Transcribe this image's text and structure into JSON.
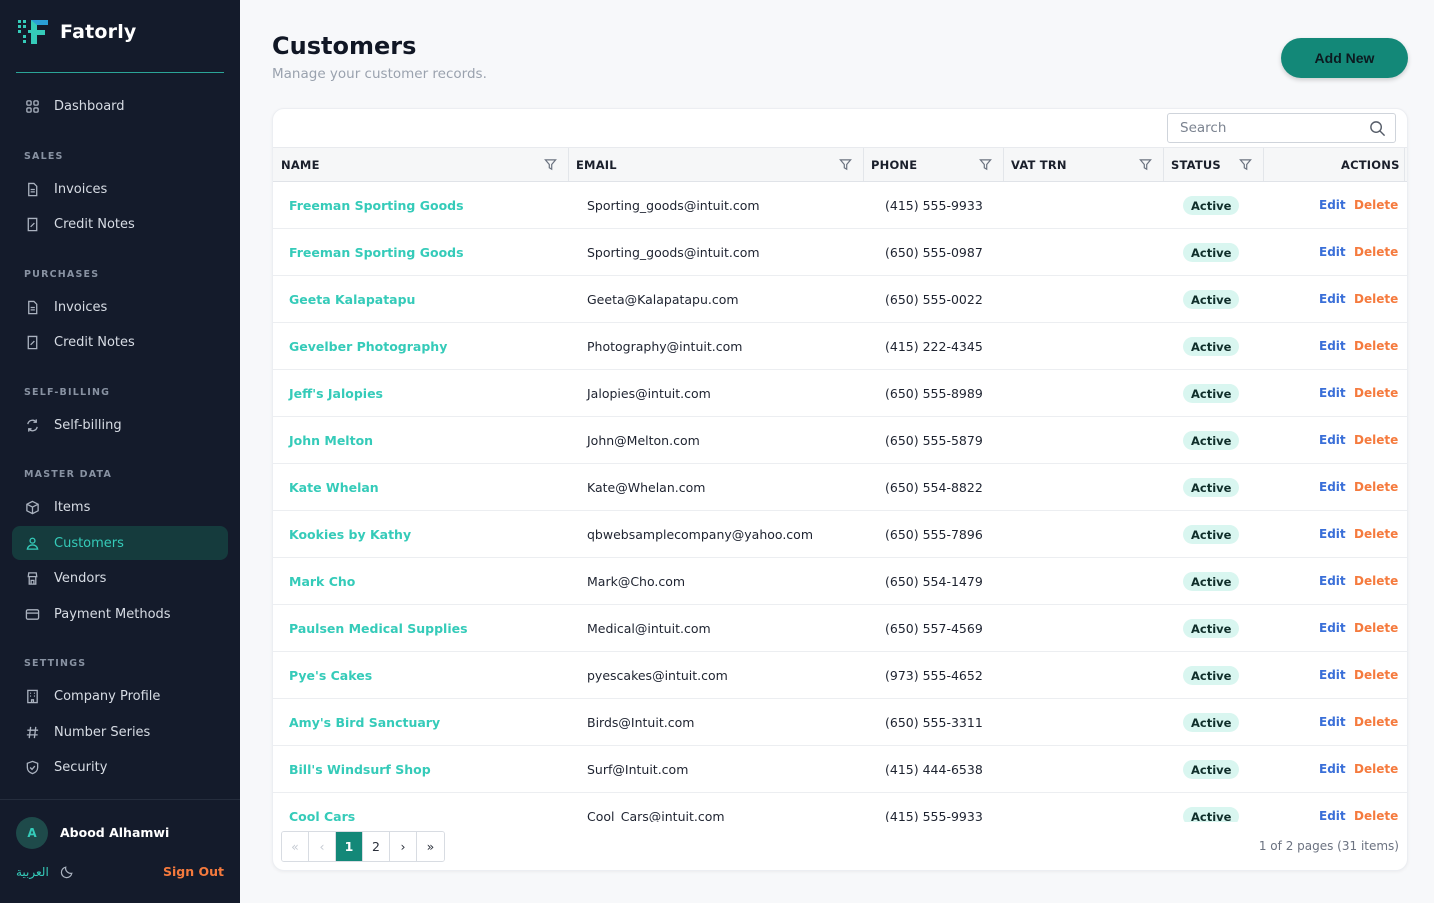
{
  "app": {
    "name": "Fatorly"
  },
  "colors": {
    "accent": "#138878",
    "link": "#35cbb9",
    "danger": "#f57a3d",
    "edit": "#3a6fd8",
    "sidebar": "#141b2b"
  },
  "sidebar": {
    "dashboard": "Dashboard",
    "sections": {
      "sales": "SALES",
      "purchases": "PURCHASES",
      "self_billing": "SELF-BILLING",
      "master_data": "MASTER DATA",
      "settings": "SETTINGS"
    },
    "sales_invoices": "Invoices",
    "sales_credit_notes": "Credit Notes",
    "purchases_invoices": "Invoices",
    "purchases_credit_notes": "Credit Notes",
    "self_billing": "Self-billing",
    "items": "Items",
    "customers": "Customers",
    "vendors": "Vendors",
    "payment_methods": "Payment Methods",
    "company_profile": "Company Profile",
    "number_series": "Number Series",
    "security": "Security",
    "active_item": "Customers"
  },
  "user": {
    "initial": "A",
    "name": "Abood Alhamwi",
    "language": "العربية",
    "sign_out": "Sign Out"
  },
  "header": {
    "title": "Customers",
    "subtitle": "Manage your customer records.",
    "add_button": "Add New"
  },
  "search": {
    "placeholder": "Search"
  },
  "table": {
    "columns": {
      "name": "NAME",
      "email": "EMAIL",
      "phone": "PHONE",
      "vat": "VAT TRN",
      "status": "STATUS",
      "actions": "ACTIONS"
    },
    "edit_label": "Edit",
    "delete_label": "Delete",
    "rows": [
      {
        "name": "Freeman Sporting Goods",
        "email": "Sporting_goods@intuit.com",
        "phone": "(415) 555-9933",
        "vat": "",
        "status": "Active"
      },
      {
        "name": "Freeman Sporting Goods",
        "email": "Sporting_goods@intuit.com",
        "phone": "(650) 555-0987",
        "vat": "",
        "status": "Active"
      },
      {
        "name": "Geeta Kalapatapu",
        "email": "Geeta@Kalapatapu.com",
        "phone": "(650) 555-0022",
        "vat": "",
        "status": "Active"
      },
      {
        "name": "Gevelber Photography",
        "email": "Photography@intuit.com",
        "phone": "(415) 222-4345",
        "vat": "",
        "status": "Active"
      },
      {
        "name": "Jeff's Jalopies",
        "email": "Jalopies@intuit.com",
        "phone": "(650) 555-8989",
        "vat": "",
        "status": "Active"
      },
      {
        "name": "John Melton",
        "email": "John@Melton.com",
        "phone": "(650) 555-5879",
        "vat": "",
        "status": "Active"
      },
      {
        "name": "Kate Whelan",
        "email": "Kate@Whelan.com",
        "phone": "(650) 554-8822",
        "vat": "",
        "status": "Active"
      },
      {
        "name": "Kookies by Kathy",
        "email": "qbwebsamplecompany@yahoo.com",
        "phone": "(650) 555-7896",
        "vat": "",
        "status": "Active"
      },
      {
        "name": "Mark Cho",
        "email": "Mark@Cho.com",
        "phone": "(650) 554-1479",
        "vat": "",
        "status": "Active"
      },
      {
        "name": "Paulsen Medical Supplies",
        "email": "Medical@intuit.com",
        "phone": "(650) 557-4569",
        "vat": "",
        "status": "Active"
      },
      {
        "name": "Pye's Cakes",
        "email": "pyescakes@intuit.com",
        "phone": "(973) 555-4652",
        "vat": "",
        "status": "Active"
      },
      {
        "name": "Amy's Bird Sanctuary",
        "email": "Birds@Intuit.com",
        "phone": "(650) 555-3311",
        "vat": "",
        "status": "Active"
      },
      {
        "name": "Bill's Windsurf Shop",
        "email": "Surf@Intuit.com",
        "phone": "(415) 444-6538",
        "vat": "",
        "status": "Active"
      },
      {
        "name": "Cool Cars",
        "email": "Cool_Cars@intuit.com",
        "phone": "(415) 555-9933",
        "vat": "",
        "status": "Active"
      }
    ]
  },
  "pagination": {
    "first": "«",
    "prev": "‹",
    "next": "›",
    "last": "»",
    "pages": [
      "1",
      "2"
    ],
    "current": "1",
    "info": "1 of 2 pages (31 items)"
  },
  "icons": {
    "dashboard": "grid-icon",
    "invoice": "document-icon",
    "credit_note": "receipt-icon",
    "self_billing": "refresh-icon",
    "items": "box-icon",
    "customers": "users-icon",
    "vendors": "store-icon",
    "payment_methods": "card-icon",
    "company_profile": "building-icon",
    "number_series": "hash-icon",
    "security": "shield-icon",
    "theme": "moon-icon",
    "search": "search-icon",
    "filter": "filter-icon"
  }
}
